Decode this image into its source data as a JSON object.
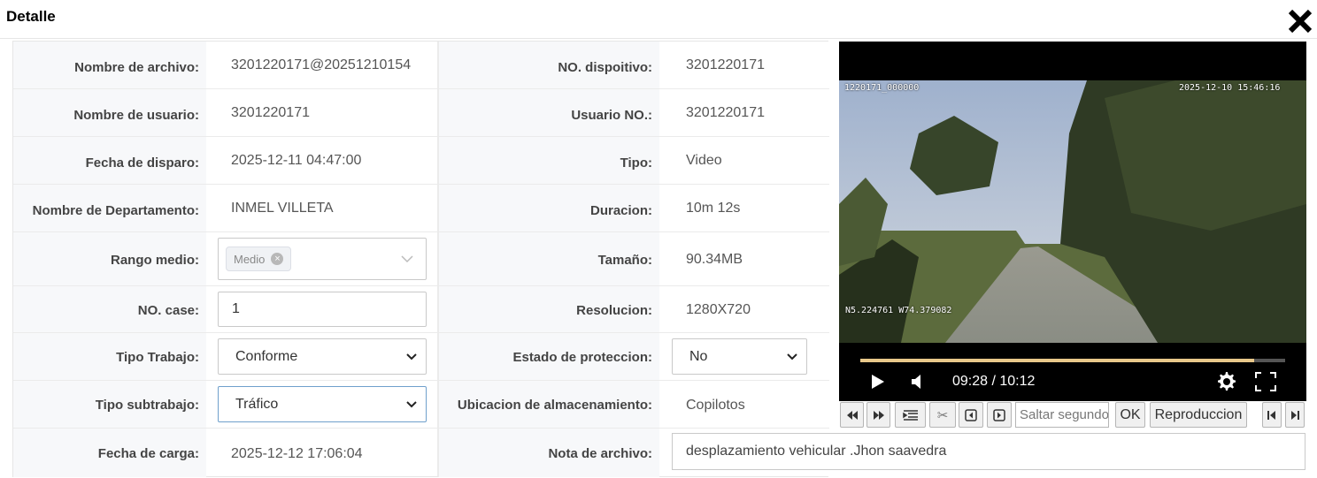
{
  "dialog": {
    "title": "Detalle",
    "close_icon": "close-icon"
  },
  "fields": {
    "nombre_archivo": {
      "label": "Nombre de archivo:",
      "value": "3201220171@20251210154"
    },
    "no_dispositivo": {
      "label": "NO. dispoitivo:",
      "value": "3201220171"
    },
    "nombre_usuario": {
      "label": "Nombre de usuario:",
      "value": "3201220171"
    },
    "usuario_no": {
      "label": "Usuario NO.:",
      "value": "3201220171"
    },
    "fecha_disparo": {
      "label": "Fecha de disparo:",
      "value": "2025-12-11 04:47:00"
    },
    "tipo": {
      "label": "Tipo:",
      "value": "Video"
    },
    "nombre_departamento": {
      "label": "Nombre de Departamento:",
      "value": "INMEL VILLETA"
    },
    "duracion": {
      "label": "Duracion:",
      "value": "10m 12s"
    },
    "rango_medio": {
      "label": "Rango medio:",
      "tag": "Medio"
    },
    "tamano": {
      "label": "Tamaño:",
      "value": "90.34MB"
    },
    "no_case": {
      "label": "NO. case:",
      "value": "1"
    },
    "resolucion": {
      "label": "Resolucion:",
      "value": "1280X720"
    },
    "tipo_trabajo": {
      "label": "Tipo Trabajo:",
      "selected": "Conforme"
    },
    "estado_proteccion": {
      "label": "Estado de proteccion:",
      "selected": "No"
    },
    "tipo_subtrabajo": {
      "label": "Tipo subtrabajo:",
      "selected": "Tráfico"
    },
    "ubicacion_almacenamiento": {
      "label": "Ubicacion de almacenamiento:",
      "value": "Copilotos"
    },
    "fecha_carga": {
      "label": "Fecha de carga:",
      "value": "2025-12-12 17:06:04"
    },
    "nota_archivo": {
      "label": "Nota de archivo:",
      "value": "desplazamiento vehicular .Jhon saavedra"
    }
  },
  "video": {
    "osd_id": "1220171_000000",
    "osd_datetime": "2025-12-10  15:46:16",
    "osd_gps": "N5.224761  W74.379082",
    "time_display": "09:28 / 10:12",
    "progress": 0.928,
    "colors": {
      "progress": "#e8c88a",
      "track": "#555555"
    }
  },
  "toolbar": {
    "seek_placeholder": "Saltar segundos",
    "ok_label": "OK",
    "playback_label": "Reproduccion"
  }
}
